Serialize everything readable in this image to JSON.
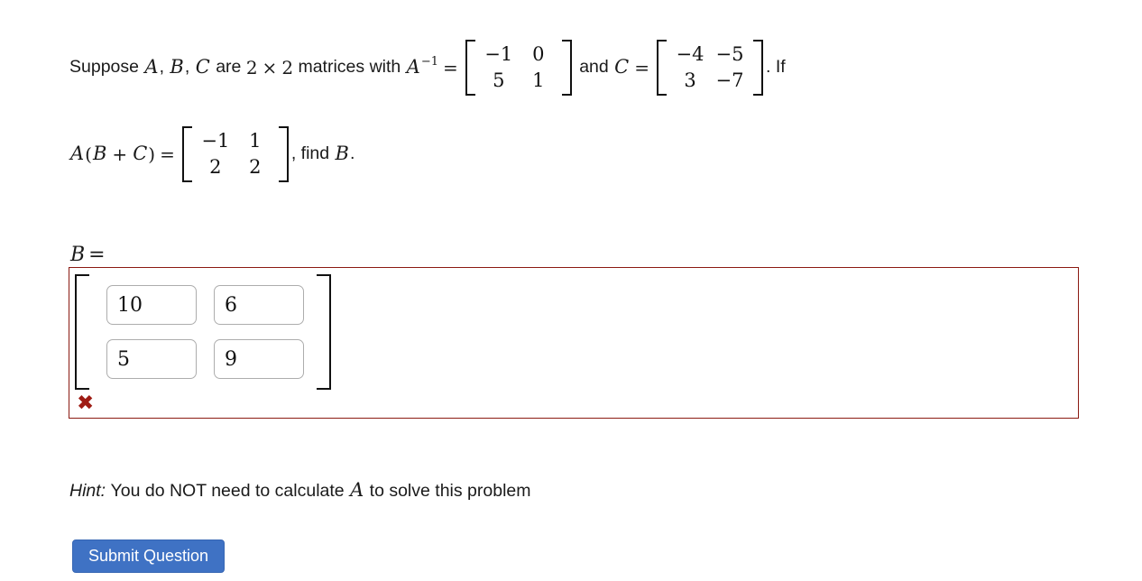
{
  "problem": {
    "line1": {
      "t1": "Suppose",
      "varA": "A",
      "c1": ",",
      "varB": "B",
      "c2": ",",
      "varC": "C",
      "t2": "are",
      "two_a": "2",
      "times": "×",
      "two_b": "2",
      "t3": "matrices with",
      "ainv_base": "A",
      "ainv_exp": "−1",
      "eq1": "=",
      "matrix_Ainv": [
        [
          "−1",
          "0"
        ],
        [
          "5",
          "1"
        ]
      ],
      "t4": "and",
      "varC2": "C",
      "eq2": "=",
      "matrix_C": [
        [
          "−4",
          "−5"
        ],
        [
          "3",
          "−7"
        ]
      ],
      "t5": ". If"
    },
    "line2": {
      "expr_A": "A",
      "paren_open": "(",
      "expr_B": "B",
      "plus": "+",
      "expr_C": "C",
      "paren_close": ")",
      "eq": "=",
      "matrix_ABC": [
        [
          "−1",
          "1"
        ],
        [
          "2",
          "2"
        ]
      ],
      "t1": ", find",
      "varB": "B",
      "period": "."
    }
  },
  "answer": {
    "label_var": "B",
    "label_eq": "=",
    "inputs": [
      {
        "name": "b11",
        "value": "10"
      },
      {
        "name": "b12",
        "value": "6"
      },
      {
        "name": "b21",
        "value": "5"
      },
      {
        "name": "b22",
        "value": "9"
      }
    ],
    "status_icon": "cross-mark-icon",
    "status_glyph": "✖",
    "status_color": "#9e1b13",
    "border_color": "#8b1a12"
  },
  "hint": {
    "label": "Hint:",
    "text_before": "You do NOT need to calculate",
    "var": "A",
    "text_after": "to solve this problem"
  },
  "submit": {
    "label": "Submit Question",
    "color": "#3f72c4"
  }
}
